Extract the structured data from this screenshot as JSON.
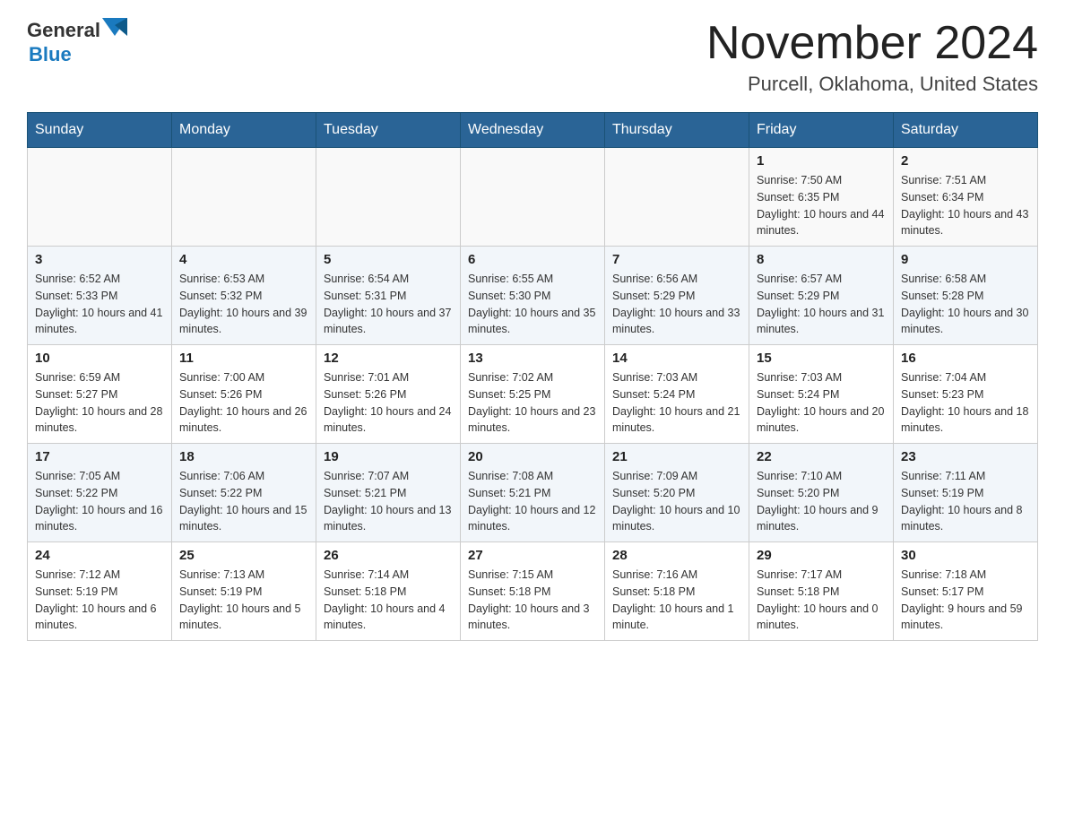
{
  "header": {
    "logo_general": "General",
    "logo_blue": "Blue",
    "month_title": "November 2024",
    "location": "Purcell, Oklahoma, United States"
  },
  "days_of_week": [
    "Sunday",
    "Monday",
    "Tuesday",
    "Wednesday",
    "Thursday",
    "Friday",
    "Saturday"
  ],
  "weeks": [
    [
      {
        "day": "",
        "sunrise": "",
        "sunset": "",
        "daylight": ""
      },
      {
        "day": "",
        "sunrise": "",
        "sunset": "",
        "daylight": ""
      },
      {
        "day": "",
        "sunrise": "",
        "sunset": "",
        "daylight": ""
      },
      {
        "day": "",
        "sunrise": "",
        "sunset": "",
        "daylight": ""
      },
      {
        "day": "",
        "sunrise": "",
        "sunset": "",
        "daylight": ""
      },
      {
        "day": "1",
        "sunrise": "Sunrise: 7:50 AM",
        "sunset": "Sunset: 6:35 PM",
        "daylight": "Daylight: 10 hours and 44 minutes."
      },
      {
        "day": "2",
        "sunrise": "Sunrise: 7:51 AM",
        "sunset": "Sunset: 6:34 PM",
        "daylight": "Daylight: 10 hours and 43 minutes."
      }
    ],
    [
      {
        "day": "3",
        "sunrise": "Sunrise: 6:52 AM",
        "sunset": "Sunset: 5:33 PM",
        "daylight": "Daylight: 10 hours and 41 minutes."
      },
      {
        "day": "4",
        "sunrise": "Sunrise: 6:53 AM",
        "sunset": "Sunset: 5:32 PM",
        "daylight": "Daylight: 10 hours and 39 minutes."
      },
      {
        "day": "5",
        "sunrise": "Sunrise: 6:54 AM",
        "sunset": "Sunset: 5:31 PM",
        "daylight": "Daylight: 10 hours and 37 minutes."
      },
      {
        "day": "6",
        "sunrise": "Sunrise: 6:55 AM",
        "sunset": "Sunset: 5:30 PM",
        "daylight": "Daylight: 10 hours and 35 minutes."
      },
      {
        "day": "7",
        "sunrise": "Sunrise: 6:56 AM",
        "sunset": "Sunset: 5:29 PM",
        "daylight": "Daylight: 10 hours and 33 minutes."
      },
      {
        "day": "8",
        "sunrise": "Sunrise: 6:57 AM",
        "sunset": "Sunset: 5:29 PM",
        "daylight": "Daylight: 10 hours and 31 minutes."
      },
      {
        "day": "9",
        "sunrise": "Sunrise: 6:58 AM",
        "sunset": "Sunset: 5:28 PM",
        "daylight": "Daylight: 10 hours and 30 minutes."
      }
    ],
    [
      {
        "day": "10",
        "sunrise": "Sunrise: 6:59 AM",
        "sunset": "Sunset: 5:27 PM",
        "daylight": "Daylight: 10 hours and 28 minutes."
      },
      {
        "day": "11",
        "sunrise": "Sunrise: 7:00 AM",
        "sunset": "Sunset: 5:26 PM",
        "daylight": "Daylight: 10 hours and 26 minutes."
      },
      {
        "day": "12",
        "sunrise": "Sunrise: 7:01 AM",
        "sunset": "Sunset: 5:26 PM",
        "daylight": "Daylight: 10 hours and 24 minutes."
      },
      {
        "day": "13",
        "sunrise": "Sunrise: 7:02 AM",
        "sunset": "Sunset: 5:25 PM",
        "daylight": "Daylight: 10 hours and 23 minutes."
      },
      {
        "day": "14",
        "sunrise": "Sunrise: 7:03 AM",
        "sunset": "Sunset: 5:24 PM",
        "daylight": "Daylight: 10 hours and 21 minutes."
      },
      {
        "day": "15",
        "sunrise": "Sunrise: 7:03 AM",
        "sunset": "Sunset: 5:24 PM",
        "daylight": "Daylight: 10 hours and 20 minutes."
      },
      {
        "day": "16",
        "sunrise": "Sunrise: 7:04 AM",
        "sunset": "Sunset: 5:23 PM",
        "daylight": "Daylight: 10 hours and 18 minutes."
      }
    ],
    [
      {
        "day": "17",
        "sunrise": "Sunrise: 7:05 AM",
        "sunset": "Sunset: 5:22 PM",
        "daylight": "Daylight: 10 hours and 16 minutes."
      },
      {
        "day": "18",
        "sunrise": "Sunrise: 7:06 AM",
        "sunset": "Sunset: 5:22 PM",
        "daylight": "Daylight: 10 hours and 15 minutes."
      },
      {
        "day": "19",
        "sunrise": "Sunrise: 7:07 AM",
        "sunset": "Sunset: 5:21 PM",
        "daylight": "Daylight: 10 hours and 13 minutes."
      },
      {
        "day": "20",
        "sunrise": "Sunrise: 7:08 AM",
        "sunset": "Sunset: 5:21 PM",
        "daylight": "Daylight: 10 hours and 12 minutes."
      },
      {
        "day": "21",
        "sunrise": "Sunrise: 7:09 AM",
        "sunset": "Sunset: 5:20 PM",
        "daylight": "Daylight: 10 hours and 10 minutes."
      },
      {
        "day": "22",
        "sunrise": "Sunrise: 7:10 AM",
        "sunset": "Sunset: 5:20 PM",
        "daylight": "Daylight: 10 hours and 9 minutes."
      },
      {
        "day": "23",
        "sunrise": "Sunrise: 7:11 AM",
        "sunset": "Sunset: 5:19 PM",
        "daylight": "Daylight: 10 hours and 8 minutes."
      }
    ],
    [
      {
        "day": "24",
        "sunrise": "Sunrise: 7:12 AM",
        "sunset": "Sunset: 5:19 PM",
        "daylight": "Daylight: 10 hours and 6 minutes."
      },
      {
        "day": "25",
        "sunrise": "Sunrise: 7:13 AM",
        "sunset": "Sunset: 5:19 PM",
        "daylight": "Daylight: 10 hours and 5 minutes."
      },
      {
        "day": "26",
        "sunrise": "Sunrise: 7:14 AM",
        "sunset": "Sunset: 5:18 PM",
        "daylight": "Daylight: 10 hours and 4 minutes."
      },
      {
        "day": "27",
        "sunrise": "Sunrise: 7:15 AM",
        "sunset": "Sunset: 5:18 PM",
        "daylight": "Daylight: 10 hours and 3 minutes."
      },
      {
        "day": "28",
        "sunrise": "Sunrise: 7:16 AM",
        "sunset": "Sunset: 5:18 PM",
        "daylight": "Daylight: 10 hours and 1 minute."
      },
      {
        "day": "29",
        "sunrise": "Sunrise: 7:17 AM",
        "sunset": "Sunset: 5:18 PM",
        "daylight": "Daylight: 10 hours and 0 minutes."
      },
      {
        "day": "30",
        "sunrise": "Sunrise: 7:18 AM",
        "sunset": "Sunset: 5:17 PM",
        "daylight": "Daylight: 9 hours and 59 minutes."
      }
    ]
  ]
}
